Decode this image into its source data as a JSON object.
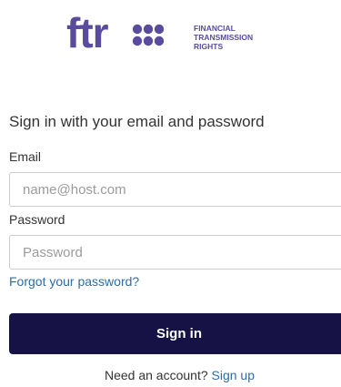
{
  "logo": {
    "wordmark": "ftr",
    "tagline_lines": [
      "FINANCIAL",
      "TRANSMISSION",
      "RIGHTS"
    ],
    "color": "#5a4b9e"
  },
  "form": {
    "heading": "Sign in with your email and password",
    "email_label": "Email",
    "email_placeholder": "name@host.com",
    "email_value": "",
    "password_label": "Password",
    "password_placeholder": "Password",
    "password_value": "",
    "forgot_link": "Forgot your password?",
    "submit_label": "Sign in",
    "submit_color": "#161245"
  },
  "signup": {
    "prompt": "Need an account?",
    "link": "Sign up",
    "link_color": "#2e6da4"
  }
}
